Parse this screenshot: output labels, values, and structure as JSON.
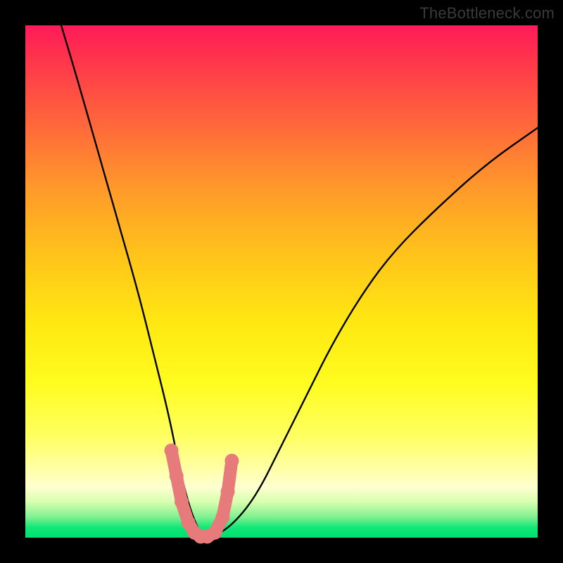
{
  "watermark": "TheBottleneck.com",
  "chart_data": {
    "type": "line",
    "title": "",
    "xlabel": "",
    "ylabel": "",
    "xlim": [
      0,
      100
    ],
    "ylim": [
      0,
      100
    ],
    "series": [
      {
        "name": "bottleneck-curve",
        "x": [
          7,
          10,
          14,
          18,
          22,
          25,
          28,
          30,
          32,
          34,
          36,
          40,
          45,
          50,
          55,
          60,
          66,
          72,
          80,
          90,
          100
        ],
        "y": [
          100,
          90,
          76,
          62,
          48,
          36,
          24,
          14,
          6,
          1,
          0,
          2,
          8,
          18,
          28,
          38,
          48,
          56,
          64,
          73,
          80
        ]
      }
    ],
    "markers": {
      "name": "highlight-segment",
      "color": "#e77a7a",
      "x": [
        28.5,
        29.5,
        30.5,
        31.8,
        33.0,
        34.2,
        35.5,
        37.0,
        38.5,
        39.5,
        40.3
      ],
      "y": [
        17,
        12,
        7,
        3,
        1,
        0.2,
        0.2,
        1,
        4,
        9,
        15
      ]
    },
    "background_gradient": {
      "top": "#ff1a58",
      "upper_mid": "#ffc41a",
      "lower_mid": "#ffff60",
      "bottom": "#00e070"
    }
  }
}
